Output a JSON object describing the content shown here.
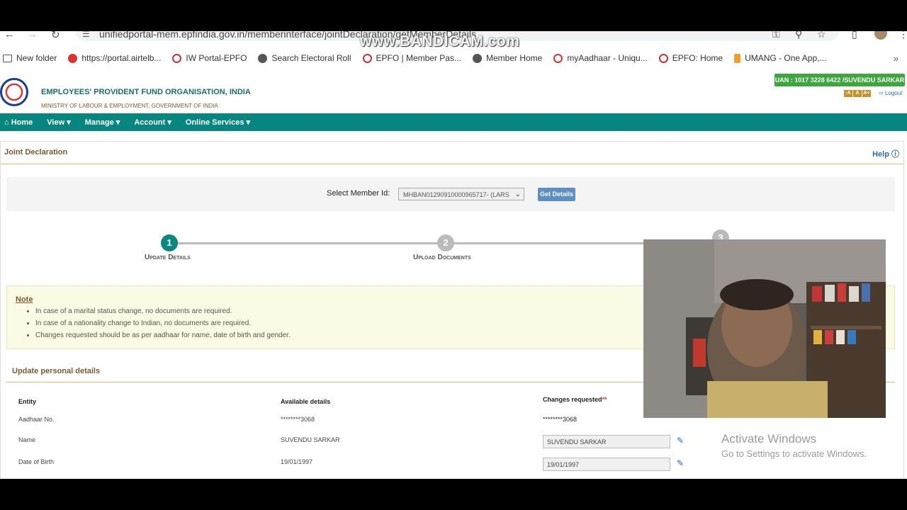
{
  "browser": {
    "url": "unifiedportal-mem.epfindia.gov.in/memberinterface/jointDeclaration/getMemberDetails",
    "bookmarks": [
      {
        "label": "New folder"
      },
      {
        "label": "https://portal.airtelb..."
      },
      {
        "label": "IW Portal-EPFO"
      },
      {
        "label": "Search Electoral Roll"
      },
      {
        "label": "EPFO | Member Pas..."
      },
      {
        "label": "Member Home"
      },
      {
        "label": "myAadhaar - Uniqu..."
      },
      {
        "label": "EPFO: Home"
      },
      {
        "label": "UMANG - One App,..."
      }
    ]
  },
  "watermark": "www.BANDICAM.com",
  "header": {
    "org_name": "EMPLOYEES' PROVIDENT FUND ORGANISATION, INDIA",
    "org_sub": "MINISTRY OF LABOUR & EMPLOYMENT, GOVERNMENT OF INDIA",
    "uan": "UAN : 1017 3228 6422 /SUVENDU SARKAR",
    "font_small": "-A",
    "font_normal": "A",
    "font_large": "A+",
    "logout": "Logout"
  },
  "nav": {
    "home": "Home",
    "view": "View",
    "manage": "Manage",
    "account": "Account",
    "online_services": "Online Services"
  },
  "panel": {
    "title": "Joint Declaration",
    "help": "Help"
  },
  "member_select": {
    "label": "Select Member Id:",
    "value": "MHBAN01290910000965717- (LARS",
    "button": "Get Details"
  },
  "steps": [
    {
      "number": "1",
      "label": "Update Details"
    },
    {
      "number": "2",
      "label": "Upload Documents"
    },
    {
      "number": "3",
      "label": ""
    }
  ],
  "note": {
    "title": "Note",
    "items": [
      "In case of a marital status change, no documents are required.",
      "In case of a nationality change to Indian, no documents are required.",
      "Changes requested should be as per aadhaar for name, date of birth and gender."
    ]
  },
  "personal": {
    "section_title": "Update personal details",
    "headers": {
      "entity": "Entity",
      "available": "Available details",
      "changes": "Changes requested",
      "required_mark": "**"
    },
    "rows": [
      {
        "entity": "Aadhaar No.",
        "available": "********3068",
        "changes": "********3068"
      },
      {
        "entity": "Name",
        "available": "SUVENDU SARKAR",
        "changes": "SUVENDU SARKAR"
      },
      {
        "entity": "Date of Birth",
        "available": "19/01/1997",
        "changes": "19/01/1997"
      }
    ]
  },
  "os_watermark": {
    "title": "Activate Windows",
    "subtitle": "Go to Settings to activate Windows."
  },
  "colors": {
    "nav_green": "#06867e",
    "uan_green": "#3ea63e",
    "button_blue": "#5d8ec6",
    "title_brown": "#7a5a30"
  }
}
